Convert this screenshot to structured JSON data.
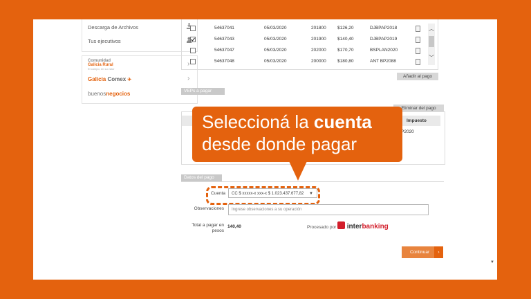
{
  "sidebar": {
    "items": [
      {
        "label": "Descarga de Archivos",
        "icon": "download-icon"
      },
      {
        "label": "Tus ejecutivos",
        "icon": "person-icon"
      }
    ],
    "promos": [
      {
        "line1": "Comunidad",
        "line2": "Galicia Rural",
        "line3": "El campo, en su valor",
        "icon": "rural-logo"
      },
      {
        "label_a": "Galicia",
        "label_b": "Comex",
        "icon": "comex-logo"
      },
      {
        "label_a": "buenos",
        "label_b": "negocios",
        "icon": "buenos-negocios-logo"
      }
    ]
  },
  "top_table": {
    "rows": [
      {
        "checked": false,
        "num": "54637041",
        "date": "05/03/2020",
        "code": "201800",
        "amount": "$126,20",
        "tax": "DJBPAP2018"
      },
      {
        "checked": true,
        "num": "54637043",
        "date": "05/03/2020",
        "code": "201900",
        "amount": "$140,40",
        "tax": "DJBPAP2019"
      },
      {
        "checked": false,
        "num": "54637047",
        "date": "05/03/2020",
        "code": "202000",
        "amount": "$170,70",
        "tax": "BSPLAN2020"
      },
      {
        "checked": false,
        "num": "54637048",
        "date": "05/03/2020",
        "code": "200000",
        "amount": "$180,80",
        "tax": "ANT BP2088"
      }
    ],
    "add_button": "Añadir al pago"
  },
  "veps": {
    "section_title": "VEPs a pagar",
    "delete_button": "Eliminar del pago",
    "col_tax": "Impuesto",
    "row_tax_fragment": "P2020"
  },
  "callout": {
    "part1": "Seleccioná la ",
    "bold": "cuenta",
    "line2": "desde donde pagar"
  },
  "payment": {
    "section_title": "Datos del pago",
    "cuenta_label": "Cuenta",
    "cuenta_value": "CC $ xxxxx-x xxx-x  $ 1.023.437.677,82",
    "obs_label": "Observaciones",
    "obs_placeholder": "Ingrese observaciones a su operación",
    "total_label_1": "Total a pagar en",
    "total_label_2": "pesos",
    "total_value": "140,40",
    "processed_by": "Procesado por",
    "brand_a": "inter",
    "brand_b": "banking",
    "continue_button": "Continuar",
    "continue_arrow": "›"
  },
  "colors": {
    "brand_orange": "#e4620e",
    "button_orange": "#e8843e",
    "section_grey": "#c9c9c9"
  }
}
